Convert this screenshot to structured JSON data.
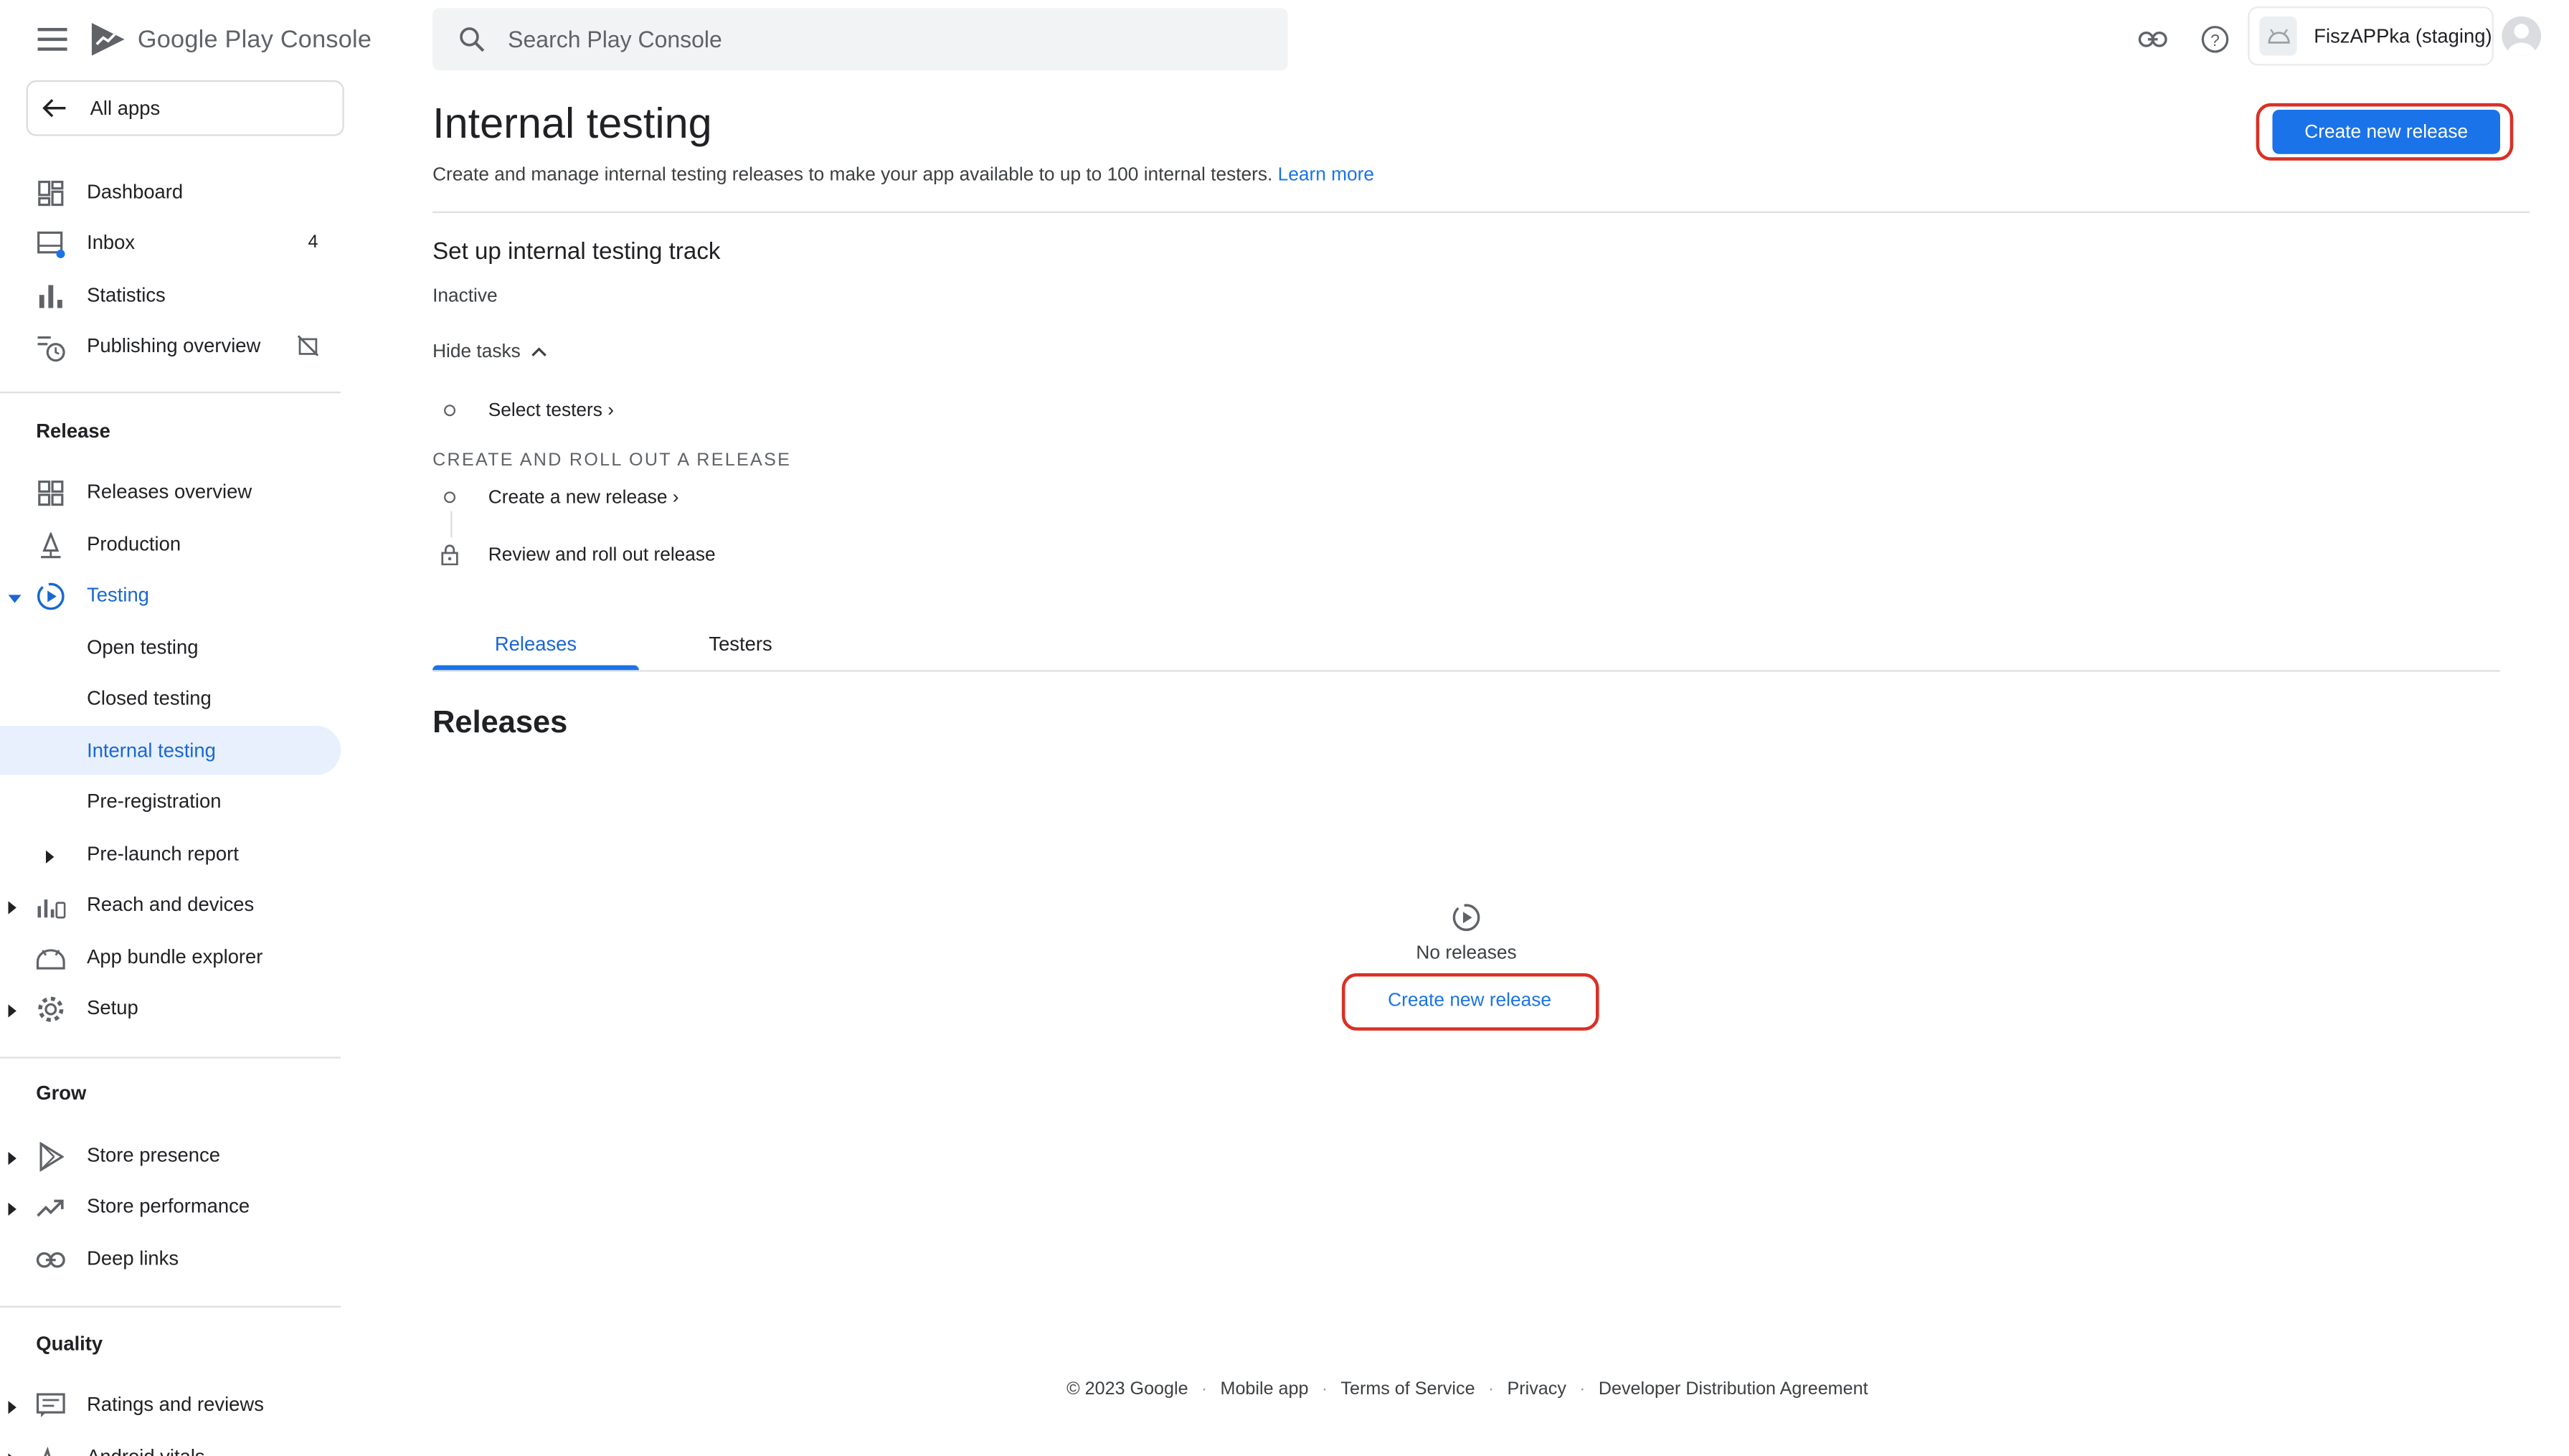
{
  "brand": {
    "name": "Google Play Console"
  },
  "search": {
    "placeholder": "Search Play Console"
  },
  "app_chip": {
    "label": "FiszAPPka (staging)"
  },
  "sidebar": {
    "all_apps": "All apps",
    "top_items": [
      {
        "label": "Dashboard"
      },
      {
        "label": "Inbox",
        "count": "4"
      },
      {
        "label": "Statistics"
      },
      {
        "label": "Publishing overview"
      }
    ],
    "release_section": "Release",
    "release_items": [
      {
        "label": "Releases overview"
      },
      {
        "label": "Production"
      },
      {
        "label": "Testing"
      },
      {
        "label": "Open testing"
      },
      {
        "label": "Closed testing"
      },
      {
        "label": "Internal testing"
      },
      {
        "label": "Pre-registration"
      },
      {
        "label": "Pre-launch report"
      },
      {
        "label": "Reach and devices"
      },
      {
        "label": "App bundle explorer"
      },
      {
        "label": "Setup"
      }
    ],
    "grow_section": "Grow",
    "grow_items": [
      {
        "label": "Store presence"
      },
      {
        "label": "Store performance"
      },
      {
        "label": "Deep links"
      }
    ],
    "quality_section": "Quality",
    "quality_items": [
      {
        "label": "Ratings and reviews"
      },
      {
        "label": "Android vitals"
      }
    ]
  },
  "page": {
    "title": "Internal testing",
    "description": "Create and manage internal testing releases to make your app available to up to 100 internal testers.",
    "learn_more": "Learn more",
    "create_button": "Create new release"
  },
  "setup": {
    "title": "Set up internal testing track",
    "status": "Inactive",
    "hide_tasks": "Hide tasks",
    "task_select_testers": "Select testers",
    "section_label": "CREATE AND ROLL OUT A RELEASE",
    "task_create_release": "Create a new release",
    "task_review": "Review and roll out release"
  },
  "tabs": [
    {
      "label": "Releases"
    },
    {
      "label": "Testers"
    }
  ],
  "releases": {
    "title": "Releases",
    "empty_text": "No releases",
    "create_link": "Create new release"
  },
  "footer": {
    "copyright": "© 2023 Google",
    "links": [
      "Mobile app",
      "Terms of Service",
      "Privacy",
      "Developer Distribution Agreement"
    ]
  },
  "colors": {
    "accent": "#1a73e8",
    "highlight": "#d93025",
    "selected_bg": "#e8f0fe"
  }
}
